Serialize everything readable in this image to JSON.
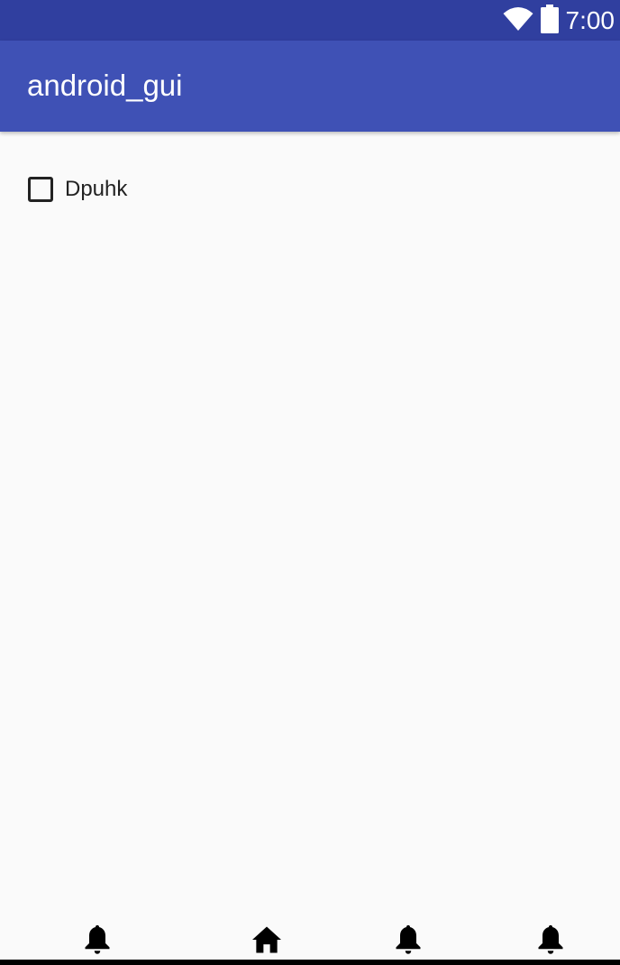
{
  "status_bar": {
    "time": "7:00",
    "icons": [
      "wifi-icon",
      "battery-icon"
    ],
    "color": "#303f9f"
  },
  "app_bar": {
    "title": "android_gui",
    "color": "#3f51b5"
  },
  "content": {
    "checkbox": {
      "label": "Dpuhk",
      "checked": false
    }
  },
  "bottom_nav": {
    "items": [
      {
        "icon": "bell-icon"
      },
      {
        "icon": "home-icon"
      },
      {
        "icon": "bell-icon"
      },
      {
        "icon": "bell-icon"
      }
    ]
  }
}
